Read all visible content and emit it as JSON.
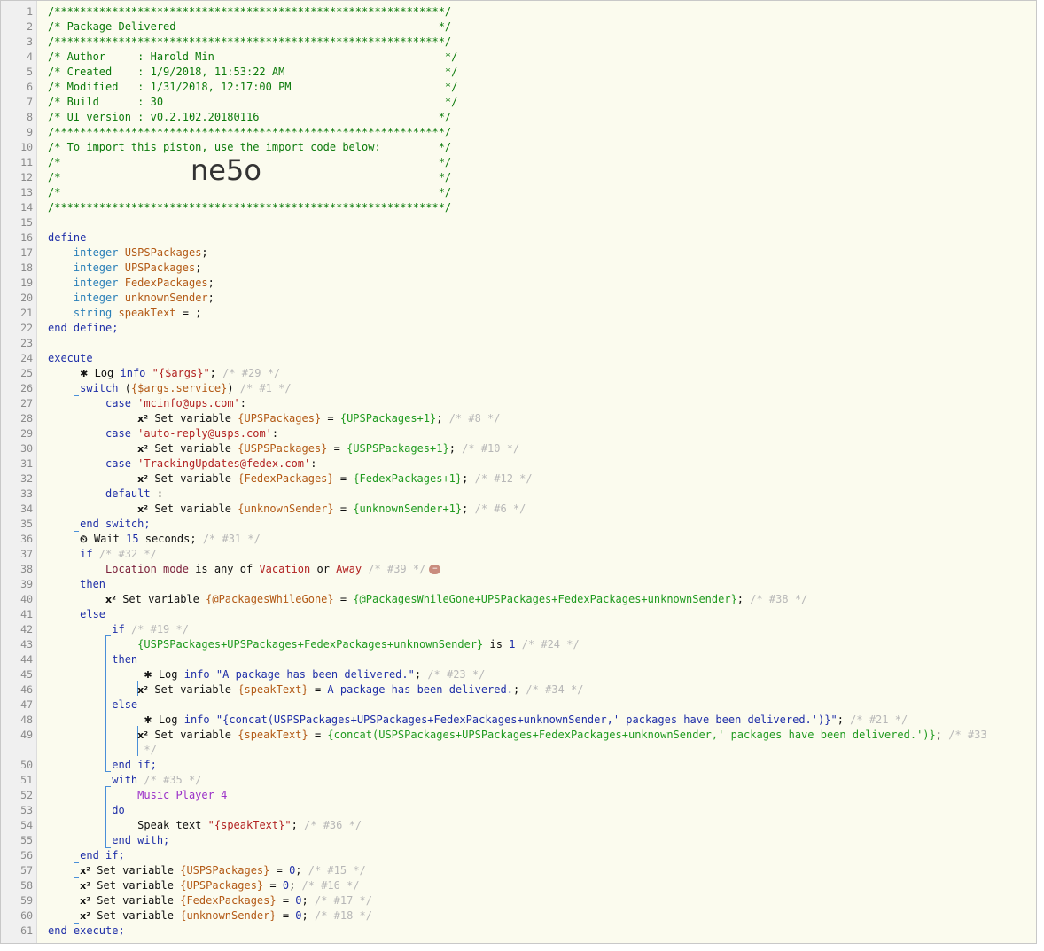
{
  "piston": {
    "banner_line": "/*************************************************************/",
    "title_line": "/* Package Delivered                                         */",
    "author_line": "/* Author     : Harold Min                                    */",
    "created_line": "/* Created    : 1/9/2018, 11:53:22 AM                         */",
    "modified_line": "/* Modified   : 1/31/2018, 12:17:00 PM                        */",
    "build_line": "/* Build      : 30                                            */",
    "ui_version_line": "/* UI version : v0.2.102.20180116                            */",
    "import_hint_line": "/* To import this piston, use the import code below:         */",
    "blank_comment_line": "/*                                                           */",
    "import_code": "ne5o"
  },
  "code": {
    "define": "define",
    "end_define": "end define;",
    "integer": "integer",
    "string": "string",
    "v_usps": "USPSPackages",
    "v_ups": "UPSPackages",
    "v_fedex": "FedexPackages",
    "v_unknown": "unknownSender",
    "v_speak": "speakText",
    "execute": "execute",
    "end_execute": "end execute;",
    "log": "Log",
    "info": "info",
    "args_str": "\"{$args}\"",
    "c29": "/* #29 */",
    "switch": "switch",
    "switch_expr": "{$args.service}",
    "c1": "/* #1 */",
    "case": "case",
    "case1": "'mcinfo@ups.com'",
    "case2": "'auto-reply@usps.com'",
    "case3": "'TrackingUpdates@fedex.com'",
    "default": "default",
    "set_variable": "Set variable",
    "sv_ups": "{UPSPackages}",
    "ex_ups": "{UPSPackages+1}",
    "c8": "/* #8 */",
    "sv_usps": "{USPSPackages}",
    "ex_usps": "{USPSPackages+1}",
    "c10": "/* #10 */",
    "sv_fedex": "{FedexPackages}",
    "ex_fedex": "{FedexPackages+1}",
    "c12": "/* #12 */",
    "sv_unknown": "{unknownSender}",
    "ex_unknown": "{unknownSender+1}",
    "c6": "/* #6 */",
    "end_switch": "end switch;",
    "wait": "Wait",
    "wait_value": "15",
    "seconds": "seconds;",
    "c31": "/* #31 */",
    "if": "if",
    "c32": "/* #32 */",
    "location_mode": "Location mode",
    "is_any_of": "is any of",
    "vacation": "Vacation",
    "or": "or",
    "away": "Away",
    "c39": "/* #39 */",
    "then": "then",
    "sv_gone": "{@PackagesWhileGone}",
    "ex_gone": "{@PackagesWhileGone+UPSPackages+FedexPackages+unknownSender}",
    "c38": "/* #38 */",
    "else": "else",
    "c19": "/* #19 */",
    "sum_expr": "{USPSPackages+UPSPackages+FedexPackages+unknownSender}",
    "is": "is",
    "one": "1",
    "c24": "/* #24 */",
    "log_delivered": "\"A package has been delivered.\"",
    "c23": "/* #23 */",
    "sv_speak": "{speakText}",
    "speak_value": "A package has been delivered.",
    "c34": "/* #34 */",
    "log_concat": "\"{concat(USPSPackages+UPSPackages+FedexPackages+unknownSender,' packages have been delivered.')}\"",
    "c21": "/* #21 */",
    "ex_concat": "{concat(USPSPackages+UPSPackages+FedexPackages+unknownSender,' packages have been delivered.')}",
    "c33a": "/* #33",
    "c33b": "*/",
    "end_if": "end if;",
    "with": "with",
    "c35": "/* #35 */",
    "device": "Music Player 4",
    "do": "do",
    "speak_text": "Speak text",
    "speak_arg": "\"{speakText}\"",
    "c36": "/* #36 */",
    "end_with": "end with;",
    "zero": "0",
    "c15": "/* #15 */",
    "c16": "/* #16 */",
    "c17": "/* #17 */",
    "c18": "/* #18 */"
  },
  "icons": {
    "bug": "bug-icon",
    "clock": "clock-icon",
    "variable": "variable-icon",
    "remove": "remove-icon"
  },
  "colors": {
    "keyword": "#1f2fa8",
    "type": "#2a7fb8",
    "variable": "#b35a16",
    "expression": "#1f9a1f",
    "comment": "#0b7a0b",
    "disabled": "#b7b7b7",
    "bracket": "#4a8fd8"
  }
}
